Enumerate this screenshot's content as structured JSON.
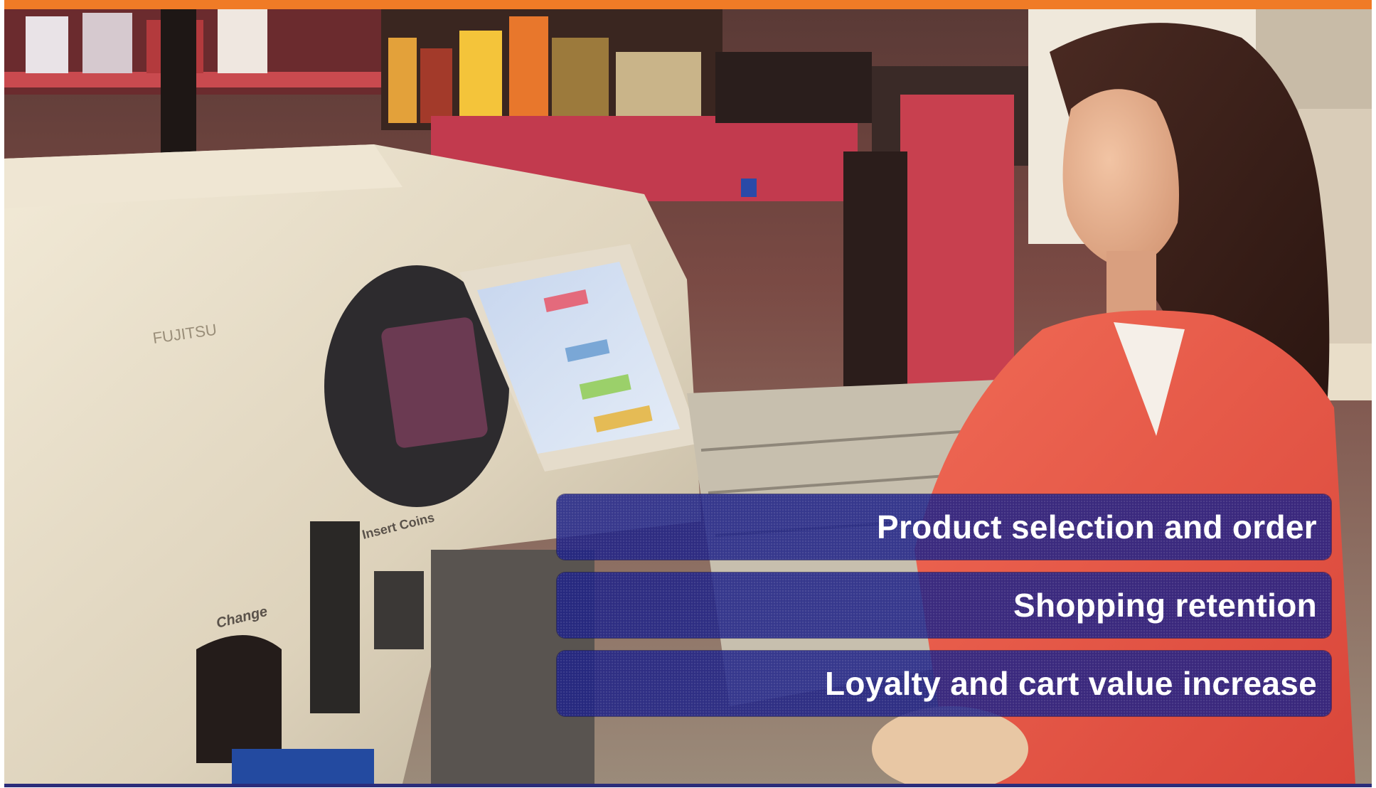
{
  "slide": {
    "accent_color": "#f07b26",
    "caption_color": "#1e2287",
    "photo_subject": "self-checkout kiosk with shopper"
  },
  "photo": {
    "brand_text": "FUJITSU",
    "kiosk_slot_label": "Insert Coins",
    "change_label": "Change"
  },
  "captions": [
    {
      "label": "Product selection and order"
    },
    {
      "label": "Shopping retention"
    },
    {
      "label": "Loyalty and cart value increase"
    }
  ]
}
